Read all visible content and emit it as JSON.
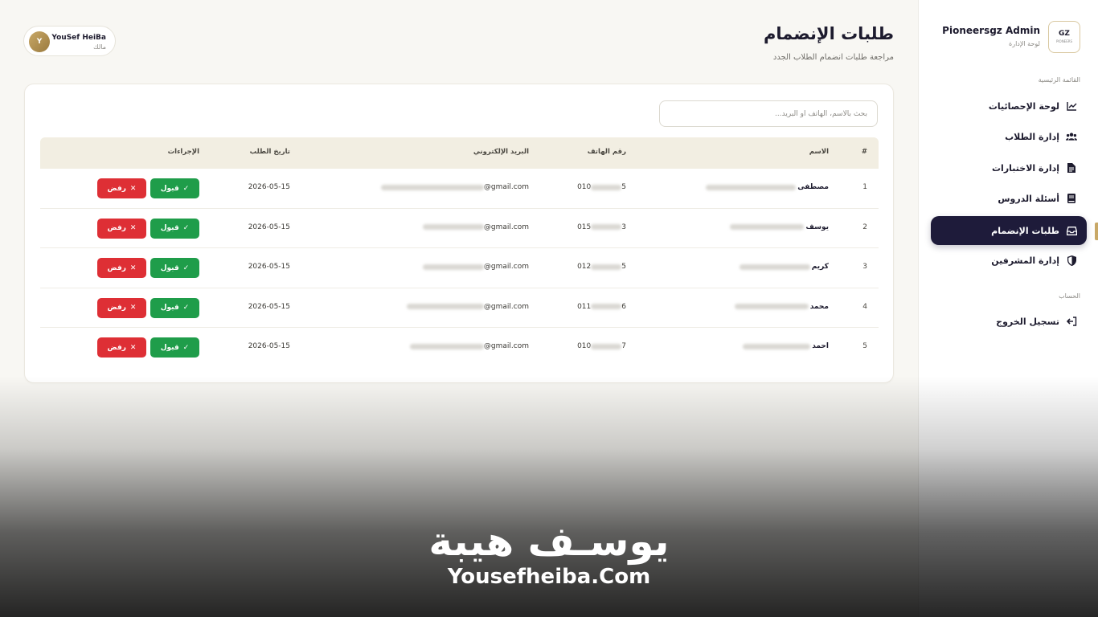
{
  "sidebar": {
    "brand_name": "Pioneersgz Admin",
    "brand_sub": "لوحة الإدارة",
    "logo_text": "GZ",
    "logo_sub": "PIONEERS",
    "main_section": "القائمة الرئيسية",
    "items": [
      {
        "label": "لوحة الإحصائيات",
        "icon": "chart-line-icon"
      },
      {
        "label": "إدارة الطلاب",
        "icon": "users-icon"
      },
      {
        "label": "إدارة الاختبارات",
        "icon": "file-icon"
      },
      {
        "label": "أسئلة الدروس",
        "icon": "book-icon"
      },
      {
        "label": "طلبات الإنضمام",
        "icon": "inbox-icon",
        "active": true
      },
      {
        "label": "إدارة المشرفين",
        "icon": "shield-icon"
      }
    ],
    "account_section": "الحساب",
    "logout_label": "تسجيل الخروج"
  },
  "header": {
    "title": "طلبات الإنضمام",
    "subtitle": "مراجعة طلبات انضمام الطلاب الجدد"
  },
  "user": {
    "initial": "Y",
    "name": "YouSef HeiBa",
    "role": "مالك"
  },
  "search": {
    "placeholder": "بحث بالاسم، الهاتف أو البريد..."
  },
  "table": {
    "headers": {
      "index": "#",
      "name": "الاسم",
      "phone": "رقم الهاتف",
      "email": "البريد الإلكتروني",
      "date": "تاريخ الطلب",
      "actions": "الإجراءات"
    },
    "accept_label": "قبول",
    "reject_label": "رفض",
    "rows": [
      {
        "index": "1",
        "name": "مصطفى",
        "phone_start": "010",
        "phone_end": "5",
        "email_domain": "@gmail.com",
        "date": "2026-05-15"
      },
      {
        "index": "2",
        "name": "يوسف",
        "phone_start": "015",
        "phone_end": "3",
        "email_domain": "@gmail.com",
        "date": "2026-05-15"
      },
      {
        "index": "3",
        "name": "كريم",
        "phone_start": "012",
        "phone_end": "5",
        "email_domain": "@gmail.com",
        "date": "2026-05-15"
      },
      {
        "index": "4",
        "name": "محمد",
        "phone_start": "011",
        "phone_end": "6",
        "email_domain": "@gmail.com",
        "date": "2026-05-15"
      },
      {
        "index": "5",
        "name": "احمد",
        "phone_start": "010",
        "phone_end": "7",
        "email_domain": "@gmail.com",
        "date": "2026-05-15"
      }
    ]
  },
  "watermark": {
    "arabic": "يوسـف هيبة",
    "english": "Yousefheiba.Com"
  },
  "colors": {
    "accent": "#1e1b3a",
    "gold": "#c8a867",
    "accept": "#1f9d4a",
    "reject": "#de2f35"
  }
}
